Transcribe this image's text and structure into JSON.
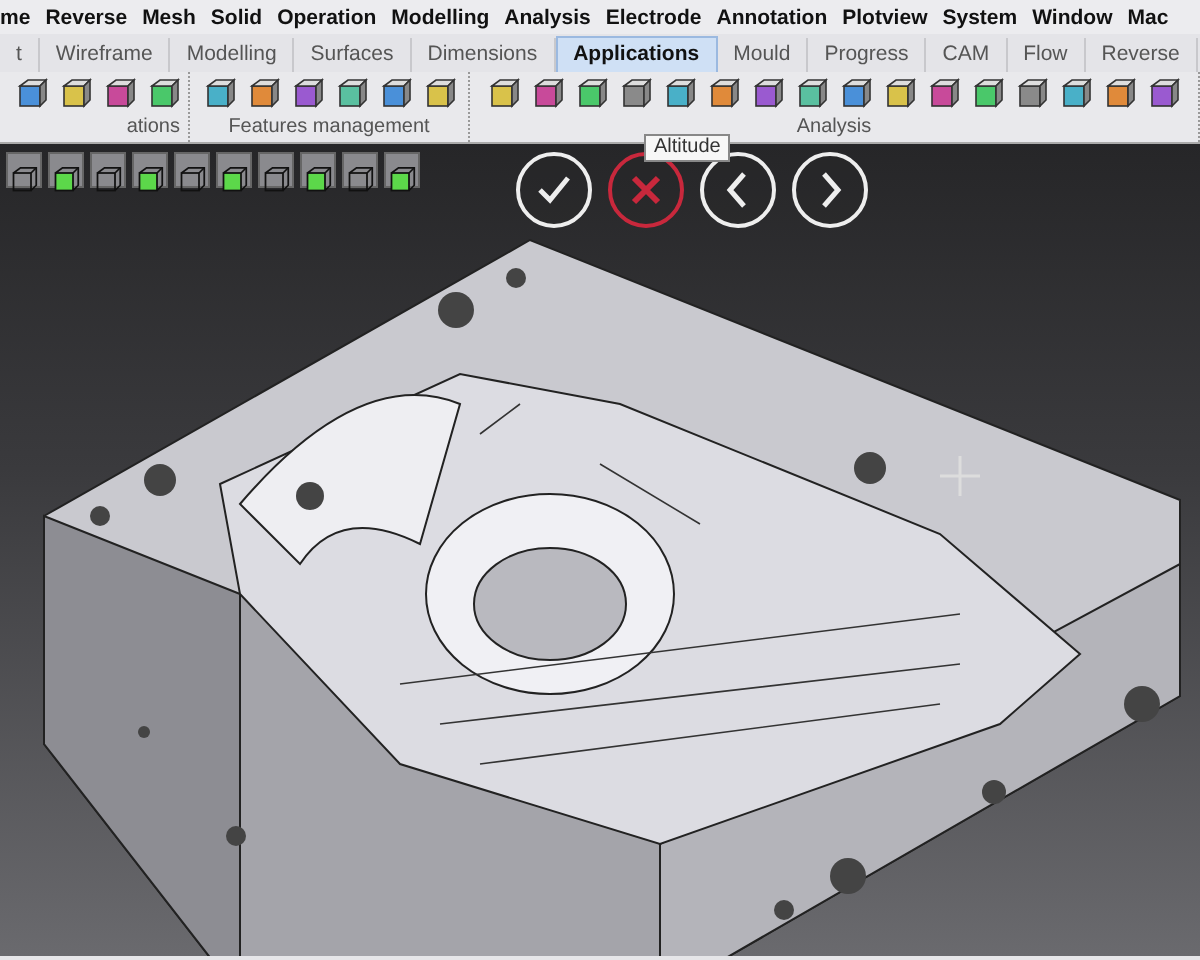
{
  "menu": [
    "me",
    "Reverse",
    "Mesh",
    "Solid",
    "Operation",
    "Modelling",
    "Analysis",
    "Electrode",
    "Annotation",
    "Plotview",
    "System",
    "Window",
    "Mac"
  ],
  "tabs": [
    {
      "label": "t",
      "selected": false
    },
    {
      "label": "Wireframe",
      "selected": false
    },
    {
      "label": "Modelling",
      "selected": false
    },
    {
      "label": "Surfaces",
      "selected": false
    },
    {
      "label": "Dimensions",
      "selected": false
    },
    {
      "label": "Applications",
      "selected": true
    },
    {
      "label": "Mould",
      "selected": false
    },
    {
      "label": "Progress",
      "selected": false
    },
    {
      "label": "CAM",
      "selected": false
    },
    {
      "label": "Flow",
      "selected": false
    },
    {
      "label": "Reverse",
      "selected": false
    }
  ],
  "ribbon_groups": [
    {
      "label": "ations"
    },
    {
      "label": "Features management"
    },
    {
      "label": "Analysis"
    }
  ],
  "tooltip": "Altitude",
  "action_buttons": [
    {
      "kind": "confirm"
    },
    {
      "kind": "cancel"
    },
    {
      "kind": "previous"
    },
    {
      "kind": "next"
    }
  ]
}
